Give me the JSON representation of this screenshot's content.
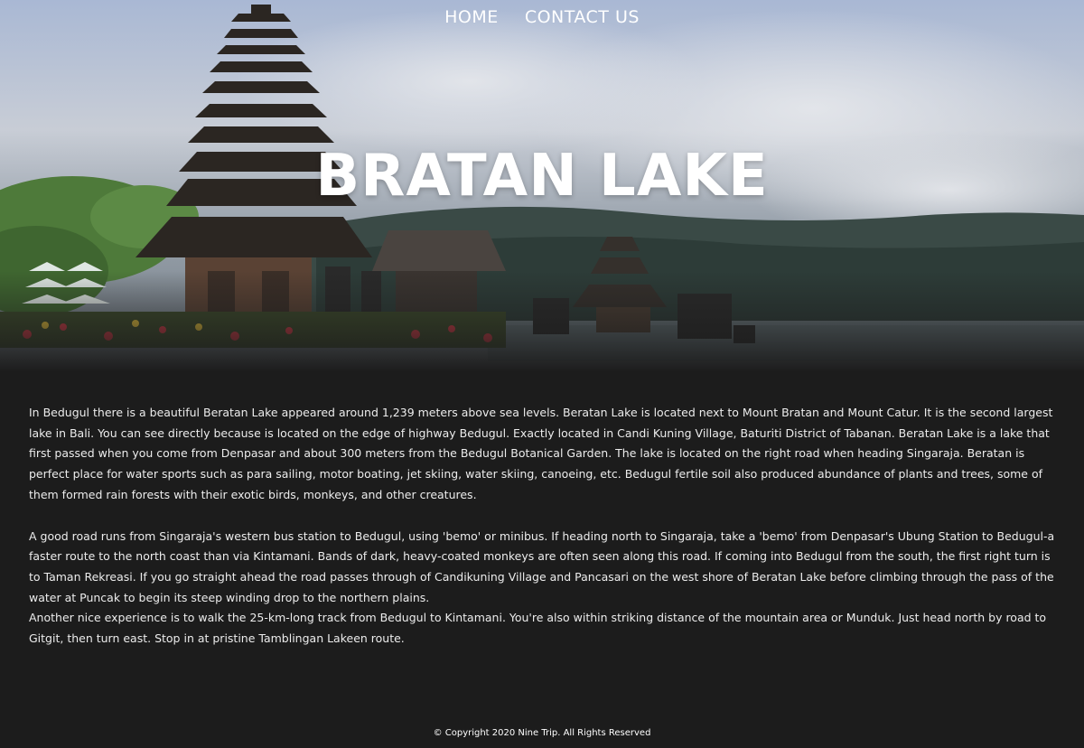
{
  "nav": {
    "items": [
      {
        "label": "HOME"
      },
      {
        "label": "CONTACT US"
      }
    ]
  },
  "hero": {
    "title": "BRATAN LAKE"
  },
  "content": {
    "paragraphs": [
      "In Bedugul there is a beautiful Beratan Lake appeared around 1,239 meters above sea levels. Beratan Lake is located next to Mount Bratan and Mount Catur. It is the second largest lake in Bali. You can see directly because is located on the edge of highway Bedugul. Exactly located in Candi Kuning Village, Baturiti District of Tabanan. Beratan Lake is a lake that first passed when you come from Denpasar and about 300 meters from the Bedugul Botanical Garden. The lake is located on the right road when heading Singaraja. Beratan is perfect place for water sports such as para sailing, motor boating, jet skiing, water skiing, canoeing, etc. Bedugul fertile soil also produced abundance of plants and trees, some of them formed rain forests with their exotic birds, monkeys, and other creatures.",
      "A good road runs from Singaraja's western bus station to Bedugul, using 'bemo' or minibus. If heading north to Singaraja, take a 'bemo' from Denpasar's Ubung Station to Bedugul-a faster route to the north coast than via Kintamani. Bands of dark, heavy-coated monkeys are often seen along this road. If coming into Bedugul from the south, the first right turn is to Taman Rekreasi. If you go straight ahead the road passes through of Candikuning Village and Pancasari on the west shore of Beratan Lake before climbing through the pass of the water at Puncak to begin its steep winding drop to the northern plains.",
      "Another nice experience is to walk the 25-km-long track from Bedugul to Kintamani. You're also within striking distance of the mountain area or Munduk. Just head north by road to Gitgit, then turn east. Stop in at pristine Tamblingan Lakeen route."
    ]
  },
  "footer": {
    "copyright": "© Copyright 2020 Nine Trip. All Rights Reserved"
  },
  "colors": {
    "page_background": "#1c1c1c",
    "text": "#ececec",
    "nav_text": "#ffffff"
  }
}
